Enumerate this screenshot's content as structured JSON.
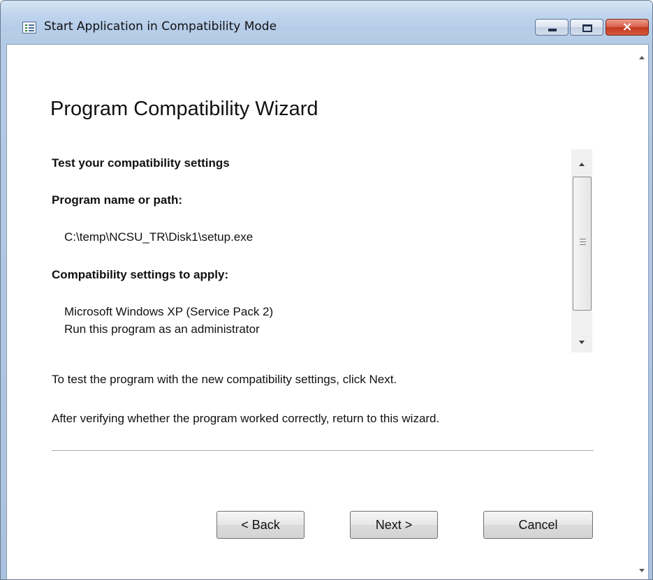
{
  "window": {
    "title": "Start Application in Compatibility Mode",
    "title_icon": "list-app-icon",
    "buttons": {
      "minimize": "minimize-icon",
      "maximize": "maximize-icon",
      "close": "×"
    }
  },
  "wizard": {
    "heading": "Program Compatibility Wizard",
    "section_title": "Test your compatibility settings",
    "program_label": "Program name or path:",
    "program_path": "C:\\temp\\NCSU_TR\\Disk1\\setup.exe",
    "settings_label": "Compatibility settings to apply:",
    "settings": [
      "Microsoft Windows XP (Service Pack 2)",
      "Run this program as an administrator"
    ],
    "instruction_1": "To test the program with the new compatibility settings, click Next.",
    "instruction_2": "After verifying whether the program worked correctly, return to this wizard."
  },
  "buttons": {
    "back": "< Back",
    "next": "Next >",
    "cancel": "Cancel"
  }
}
